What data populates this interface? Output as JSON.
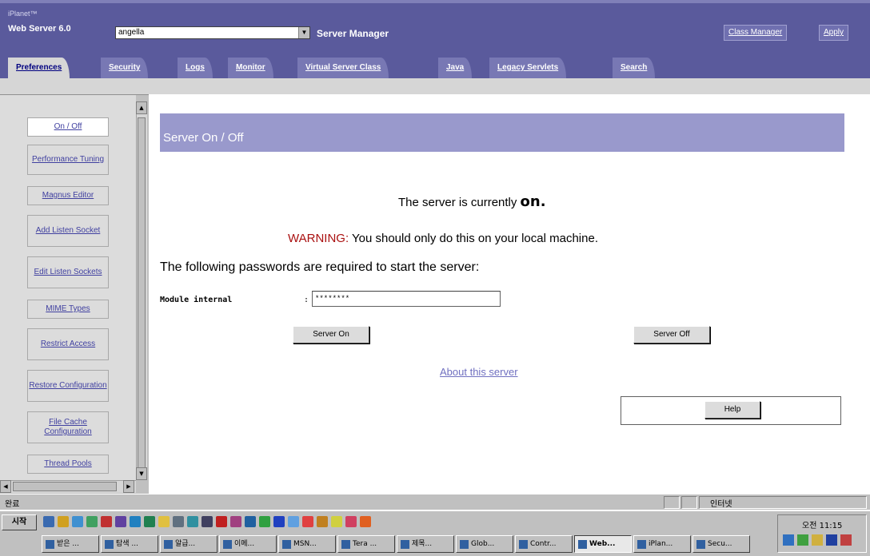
{
  "header": {
    "product_small": "iPlanet™",
    "product_name": "Web Server 6.0",
    "server_select_value": "angella",
    "manager_title": "Server Manager",
    "class_manager_label": "Class Manager",
    "apply_label": "Apply",
    "select_arrow": "▼"
  },
  "tabs": [
    {
      "label": "Preferences"
    },
    {
      "label": "Security"
    },
    {
      "label": "Logs"
    },
    {
      "label": "Monitor"
    },
    {
      "label": "Virtual Server Class"
    },
    {
      "label": "Java"
    },
    {
      "label": "Legacy Servlets"
    },
    {
      "label": "Search"
    }
  ],
  "sidebar": {
    "items": [
      {
        "label": "On / Off"
      },
      {
        "label": "Performance Tuning"
      },
      {
        "label": "Magnus Editor"
      },
      {
        "label": "Add Listen Socket"
      },
      {
        "label": "Edit Listen Sockets"
      },
      {
        "label": "MIME Types"
      },
      {
        "label": "Restrict Access"
      },
      {
        "label": "Restore Configuration"
      },
      {
        "label": "File Cache Configuration"
      },
      {
        "label": "Thread Pools"
      }
    ],
    "arrows": {
      "up": "▲",
      "down": "▼",
      "left": "◀",
      "right": "▶"
    }
  },
  "main": {
    "page_title": "Server On / Off",
    "status_prefix": "The server is currently ",
    "status_value": "on.",
    "warning_label": "WARNING:",
    "warning_text": " You should only do this on your local machine.",
    "password_heading": "The following passwords are required to start the server:",
    "module_label": "Module internal",
    "colon": ":",
    "password_value": "********",
    "server_on_label": "Server On",
    "server_off_label": "Server Off",
    "about_link": "About this server",
    "help_label": "Help"
  },
  "statusbar": {
    "status_text": "완료",
    "zone_text": "인터넷"
  },
  "taskbar": {
    "start_label": "시작",
    "clock": "오전 11:15",
    "tasks": [
      {
        "label": "받은 ..."
      },
      {
        "label": "탐색 ..."
      },
      {
        "label": "알급..."
      },
      {
        "label": "이메..."
      },
      {
        "label": "MSN..."
      },
      {
        "label": "Tera ..."
      },
      {
        "label": "제목..."
      },
      {
        "label": "Glob..."
      },
      {
        "label": "Contr..."
      },
      {
        "label": "Web..."
      },
      {
        "label": "iPlan..."
      },
      {
        "label": "Secu..."
      }
    ]
  },
  "colors": {
    "header_bg": "#5a5a9c",
    "tab_bg": "#7878b4",
    "title_bar_bg": "#9999cc",
    "warning": "#aa1111",
    "link": "#7070c0"
  }
}
